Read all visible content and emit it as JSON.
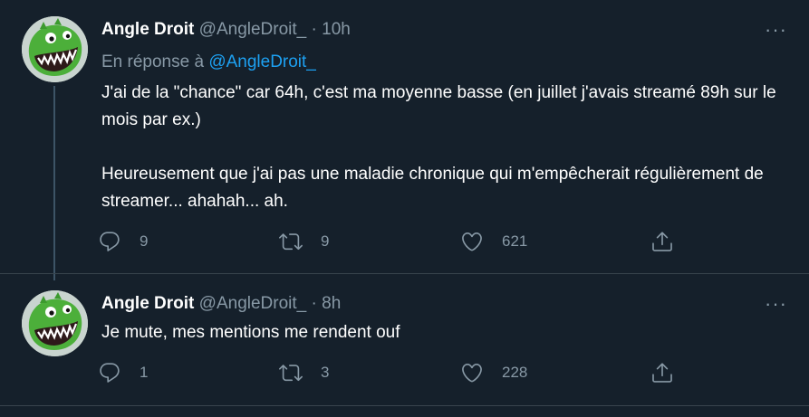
{
  "tweets": [
    {
      "name": "Angle Droit",
      "handle": "@AngleDroit_",
      "separator": "·",
      "time": "10h",
      "reply_prefix": "En réponse à",
      "reply_mention": "@AngleDroit_",
      "paragraphs": [
        "J'ai de la \"chance\" car 64h, c'est ma moyenne basse (en juillet j'avais streamé 89h sur le mois par ex.)",
        "Heureusement que j'ai pas une maladie chronique qui m'empêcherait régulièrement de streamer... ahahah... ah."
      ],
      "replies": "9",
      "retweets": "9",
      "likes": "621",
      "more": "···"
    },
    {
      "name": "Angle Droit",
      "handle": "@AngleDroit_",
      "separator": "·",
      "time": "8h",
      "paragraphs": [
        "Je mute, mes mentions me rendent ouf"
      ],
      "replies": "1",
      "retweets": "3",
      "likes": "228",
      "more": "···"
    }
  ],
  "colors": {
    "background": "#15202b",
    "muted": "#8899a6",
    "accent": "#1da1f2",
    "border": "#38444d"
  },
  "icons": [
    "reply-icon",
    "retweet-icon",
    "like-icon",
    "share-icon",
    "more-icon"
  ]
}
